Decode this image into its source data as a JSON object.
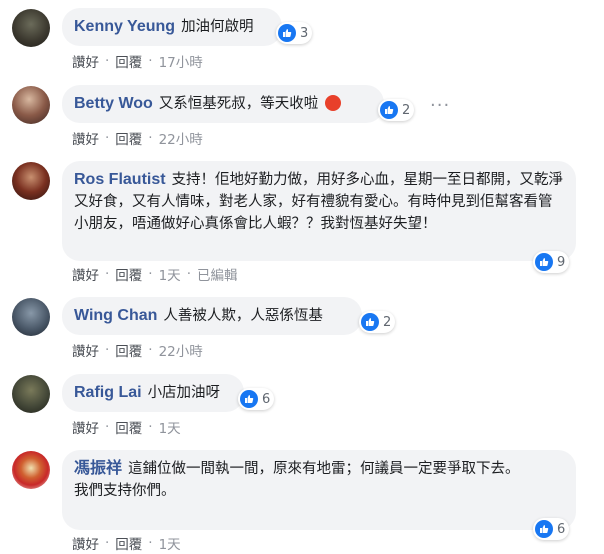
{
  "colors": {
    "link": "#385898",
    "bubble": "#f2f3f5",
    "like": "#1877f2",
    "meta": "#90949c"
  },
  "comments": [
    {
      "author": "Kenny Yeung",
      "text": "加油何啟明",
      "likes": "3",
      "like_label": "讚好",
      "reply_label": "回覆",
      "time": "17小時"
    },
    {
      "author": "Betty Woo",
      "text": "又系恒基死叔，等天收啦",
      "likes": "2",
      "like_label": "讚好",
      "reply_label": "回覆",
      "time": "22小時",
      "emoji": "angry-emoji",
      "more": "···"
    },
    {
      "author": "Ros Flautist",
      "text": "支持！佢地好勤力做，用好多心血，星期一至日都開，又乾淨又好食，又有人情味，對老人家，好有禮貌有愛心。有時仲見到佢幫客看管小朋友，唔通做好心真係會比人蝦？？我對恆基好失望！",
      "likes": "9",
      "like_label": "讚好",
      "reply_label": "回覆",
      "time": "1天",
      "edited": "已編輯"
    },
    {
      "author": "Wing Chan",
      "text": "人善被人欺，人惡係恆基",
      "likes": "2",
      "like_label": "讚好",
      "reply_label": "回覆",
      "time": "22小時"
    },
    {
      "author": "Rafig Lai",
      "text": "小店加油呀",
      "likes": "6",
      "like_label": "讚好",
      "reply_label": "回覆",
      "time": "1天"
    },
    {
      "author": "馮振祥",
      "text": "這鋪位做一間執一間，原來有地雷；何議員一定要爭取下去。",
      "text2": "我們支持你們。",
      "likes": "6",
      "like_label": "讚好",
      "reply_label": "回覆",
      "time": "1天"
    }
  ]
}
